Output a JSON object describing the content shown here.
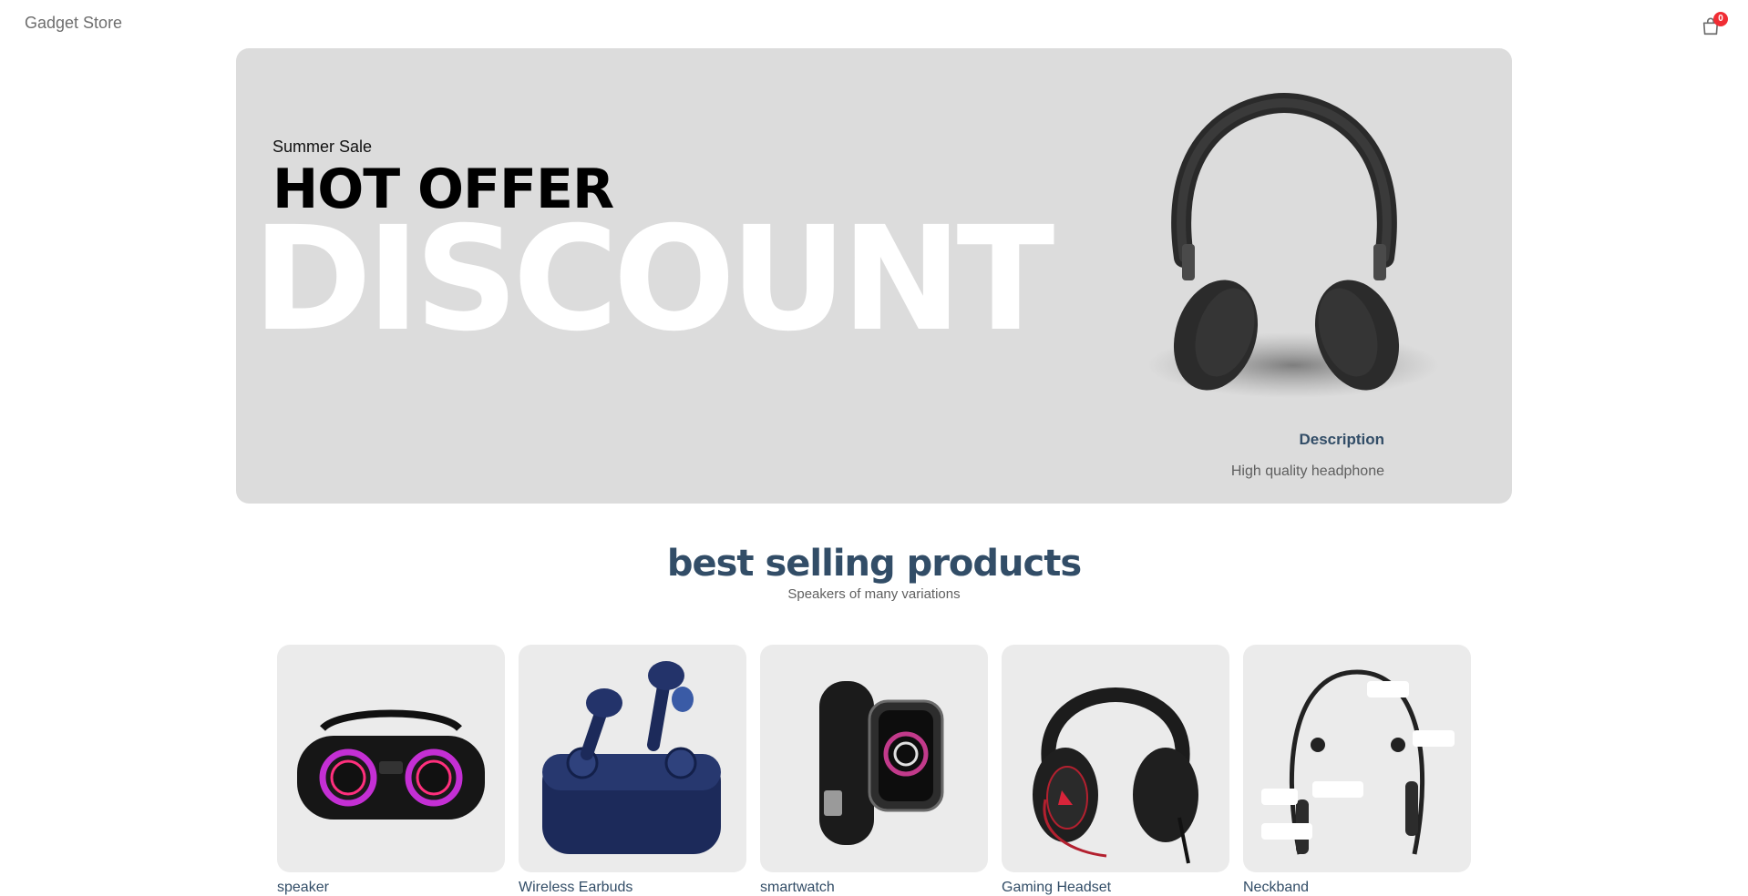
{
  "navbar": {
    "logo": "Gadget Store",
    "cart_count": "0"
  },
  "hero": {
    "small_text": "Summer Sale",
    "mid_text": "HOT OFFER",
    "large_text": "DISCOUNT",
    "desc_title": "Description",
    "desc_text": "High quality headphone"
  },
  "section": {
    "title": "best selling products",
    "subtitle": "Speakers of many variations"
  },
  "products": [
    {
      "name": "speaker"
    },
    {
      "name": "Wireless Earbuds"
    },
    {
      "name": "smartwatch"
    },
    {
      "name": "Gaming Headset"
    },
    {
      "name": "Neckband"
    }
  ],
  "colors": {
    "brand": "#324d67",
    "badge": "#f02d34",
    "hero_bg": "#dcdcdc",
    "card_bg": "#ebebeb"
  }
}
